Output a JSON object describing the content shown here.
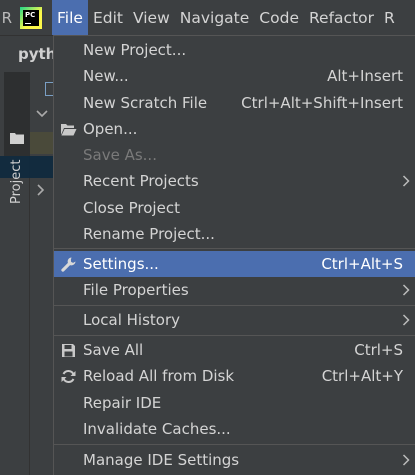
{
  "menubar": {
    "edge_left": "R",
    "logo_text": "PC",
    "items": [
      {
        "label": "File",
        "active": true
      },
      {
        "label": "Edit"
      },
      {
        "label": "View"
      },
      {
        "label": "Navigate"
      },
      {
        "label": "Code"
      },
      {
        "label": "Refactor"
      },
      {
        "label": "R"
      }
    ]
  },
  "background": {
    "project_title": "pyth",
    "project_tool_label": "Project"
  },
  "file_menu": {
    "items": [
      {
        "label": "New Project...",
        "shortcut": "",
        "icon": "",
        "submenu": false,
        "disabled": false
      },
      {
        "label": "New...",
        "shortcut": "Alt+Insert",
        "icon": "",
        "submenu": false,
        "disabled": false
      },
      {
        "label": "New Scratch File",
        "shortcut": "Ctrl+Alt+Shift+Insert",
        "icon": "",
        "submenu": false,
        "disabled": false
      },
      {
        "label": "Open...",
        "shortcut": "",
        "icon": "open-folder-icon",
        "submenu": false,
        "disabled": false
      },
      {
        "label": "Save As...",
        "shortcut": "",
        "icon": "",
        "submenu": false,
        "disabled": true
      },
      {
        "label": "Recent Projects",
        "shortcut": "",
        "icon": "",
        "submenu": true,
        "disabled": false
      },
      {
        "label": "Close Project",
        "shortcut": "",
        "icon": "",
        "submenu": false,
        "disabled": false
      },
      {
        "label": "Rename Project...",
        "shortcut": "",
        "icon": "",
        "submenu": false,
        "disabled": false
      },
      {
        "label": "Settings...",
        "shortcut": "Ctrl+Alt+S",
        "icon": "wrench-icon",
        "submenu": false,
        "disabled": false,
        "selected": true
      },
      {
        "label": "File Properties",
        "shortcut": "",
        "icon": "",
        "submenu": true,
        "disabled": false
      },
      {
        "label": "Local History",
        "shortcut": "",
        "icon": "",
        "submenu": true,
        "disabled": false
      },
      {
        "label": "Save All",
        "shortcut": "Ctrl+S",
        "icon": "save-icon",
        "submenu": false,
        "disabled": false
      },
      {
        "label": "Reload All from Disk",
        "shortcut": "Ctrl+Alt+Y",
        "icon": "reload-icon",
        "submenu": false,
        "disabled": false
      },
      {
        "label": "Repair IDE",
        "shortcut": "",
        "icon": "",
        "submenu": false,
        "disabled": false
      },
      {
        "label": "Invalidate Caches...",
        "shortcut": "",
        "icon": "",
        "submenu": false,
        "disabled": false
      },
      {
        "label": "Manage IDE Settings",
        "shortcut": "",
        "icon": "",
        "submenu": true,
        "disabled": false
      }
    ]
  },
  "colors": {
    "menu_bg": "#3c3f41",
    "selection": "#4b6eaf",
    "text": "#d4d4d4",
    "disabled_text": "#7a7a7a",
    "separator": "#555555"
  }
}
